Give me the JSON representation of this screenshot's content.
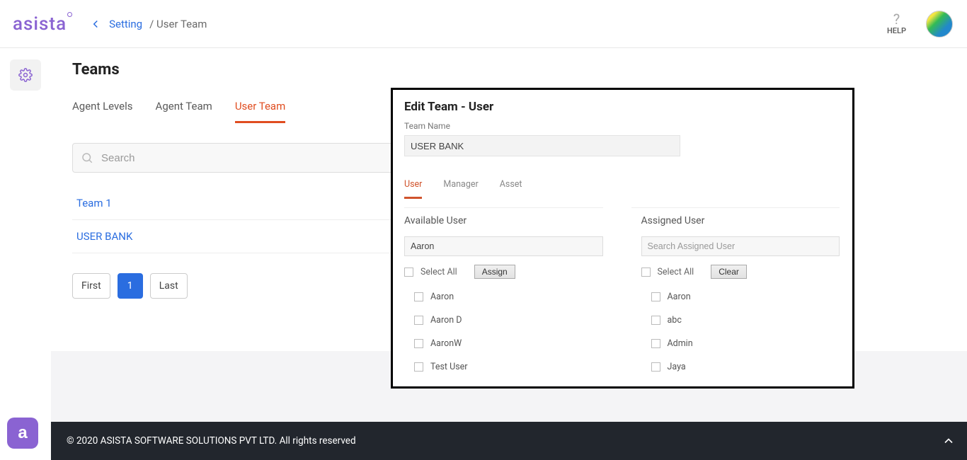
{
  "brand": "asista",
  "breadcrumb": {
    "setting": "Setting",
    "current": "/ User Team"
  },
  "help_label": "HELP",
  "page_title": "Teams",
  "tabs": [
    "Agent Levels",
    "Agent Team",
    "User Team"
  ],
  "search_placeholder": "Search",
  "teams": [
    "Team 1",
    "USER BANK"
  ],
  "pagination": {
    "first": "First",
    "page": "1",
    "last": "Last"
  },
  "panel": {
    "title": "Edit Team - User",
    "team_name_label": "Team Name",
    "team_name_value": "USER BANK",
    "tabs": [
      "User",
      "Manager",
      "Asset"
    ],
    "available": {
      "title": "Available User",
      "search_value": "Aaron",
      "select_all": "Select All",
      "button": "Assign",
      "items": [
        "Aaron",
        "Aaron D",
        "AaronW",
        "Test User"
      ]
    },
    "assigned": {
      "title": "Assigned User",
      "search_placeholder": "Search Assigned User",
      "select_all": "Select All",
      "button": "Clear",
      "items": [
        "Aaron",
        "abc",
        "Admin",
        "Jaya"
      ]
    }
  },
  "footer": "© 2020 ASISTA SOFTWARE SOLUTIONS PVT LTD. All rights reserved"
}
